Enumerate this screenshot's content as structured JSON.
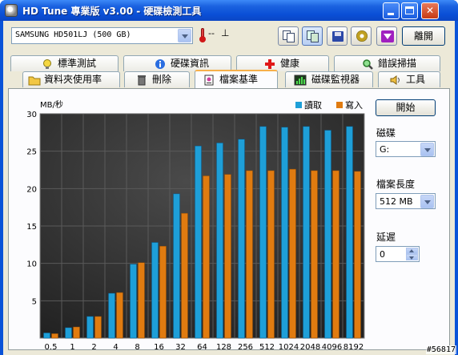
{
  "window": {
    "title": "HD Tune 專業版 v3.00 - 硬碟檢測工具"
  },
  "toolbar": {
    "drive": "SAMSUNG HD501LJ (500 GB)",
    "temperature": "--",
    "temperature_unit_icon": "⊥",
    "exit_label": "離開"
  },
  "tabs_top": [
    {
      "label": "標準測試",
      "icon": "bulb-icon"
    },
    {
      "label": "硬碟資訊",
      "icon": "info-icon"
    },
    {
      "label": "健康",
      "icon": "health-cross-icon"
    },
    {
      "label": "錯誤掃描",
      "icon": "magnifier-icon"
    }
  ],
  "tabs_bottom": [
    {
      "label": "資料夾使用率",
      "icon": "folder-icon"
    },
    {
      "label": "刪除",
      "icon": "trash-icon"
    },
    {
      "label": "檔案基準",
      "icon": "file-benchmark-icon",
      "active": true
    },
    {
      "label": "磁碟監視器",
      "icon": "monitor-chart-icon"
    },
    {
      "label": "工具",
      "icon": "speaker-icon"
    }
  ],
  "controls": {
    "start_label": "開始",
    "disk_label": "磁碟",
    "disk_value": "G:",
    "file_length_label": "檔案長度",
    "file_length_value": "512 MB",
    "delay_label": "延遲",
    "delay_value": "0"
  },
  "watermark": "#56817",
  "colors": {
    "read": "#1e9fd8",
    "write": "#e07b10",
    "chart_bg": "#2e2e2e",
    "grid": "#5a5a5a"
  },
  "chart_data": {
    "type": "bar",
    "ylabel": "MB/秒",
    "ylim": [
      0,
      30
    ],
    "yticks": [
      "5",
      "10",
      "15",
      "20",
      "25",
      "30"
    ],
    "categories": [
      "0.5",
      "1",
      "2",
      "4",
      "8",
      "16",
      "32",
      "64",
      "128",
      "256",
      "512",
      "1024",
      "2048",
      "4096",
      "8192"
    ],
    "series": [
      {
        "name": "讀取",
        "values": [
          0.7,
          1.4,
          2.9,
          6.0,
          9.9,
          12.8,
          19.3,
          25.7,
          26.1,
          26.6,
          28.3,
          28.2,
          28.3,
          27.8,
          28.3
        ]
      },
      {
        "name": "寫入",
        "values": [
          0.6,
          1.5,
          2.9,
          6.1,
          10.1,
          12.3,
          16.7,
          21.7,
          21.9,
          22.4,
          22.4,
          22.6,
          22.4,
          22.4,
          22.3
        ]
      }
    ],
    "legend": "top-right",
    "grid": true
  }
}
